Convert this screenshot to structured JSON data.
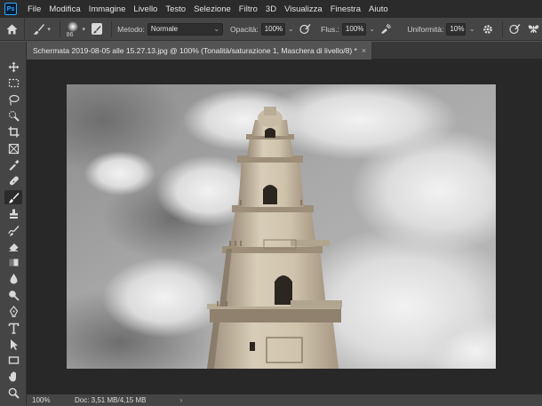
{
  "app": {
    "logo_text": "Ps"
  },
  "menu": [
    "File",
    "Modifica",
    "Immagine",
    "Livello",
    "Testo",
    "Selezione",
    "Filtro",
    "3D",
    "Visualizza",
    "Finestra",
    "Aiuto"
  ],
  "options": {
    "brush_size": "86",
    "method_label": "Metodo:",
    "method_value": "Normale",
    "opacity_label": "Opacità:",
    "opacity_value": "100%",
    "flow_label": "Flus.:",
    "flow_value": "100%",
    "smoothing_label": "Uniformità:",
    "smoothing_value": "10%"
  },
  "document": {
    "tab_title": "Schermata 2019-08-05 alle 15.27.13.jpg @ 100% (Tonalità/saturazione 1, Maschera di livello/8) *",
    "close_glyph": "×"
  },
  "status": {
    "zoom": "100%",
    "doc_info": "Doc: 3,51 MB/4,15 MB",
    "arrow": "›"
  },
  "colors": {
    "accent": "#31a8ff",
    "panel": "#454545",
    "canvas_bg": "#282828",
    "menubar": "#2b2b2b"
  },
  "tools": [
    "move-tool",
    "marquee-tool",
    "lasso-tool",
    "quick-selection-tool",
    "crop-tool",
    "frame-tool",
    "eyedropper-tool",
    "healing-brush-tool",
    "brush-tool",
    "clone-stamp-tool",
    "history-brush-tool",
    "eraser-tool",
    "gradient-tool",
    "blur-tool",
    "dodge-tool",
    "pen-tool",
    "type-tool",
    "path-selection-tool",
    "rectangle-tool",
    "hand-tool",
    "zoom-tool"
  ]
}
